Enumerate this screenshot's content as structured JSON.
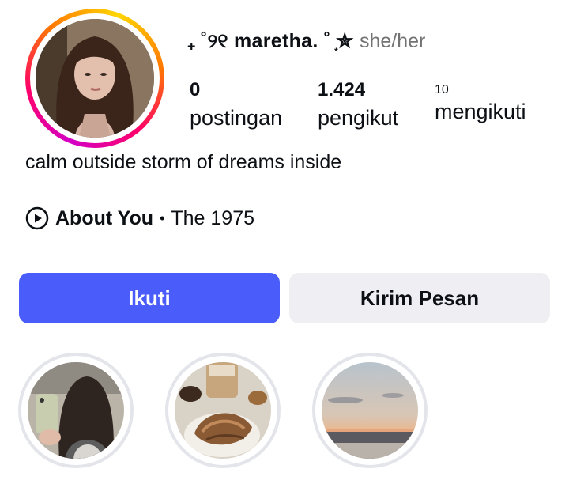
{
  "profile": {
    "username": "₊ ˚୨୧ maretha. ˚ ͙✮",
    "pronouns": "she/her",
    "bio": "calm outside storm of dreams inside"
  },
  "stats": [
    {
      "value": "0",
      "label": "postingan"
    },
    {
      "value": "1.424",
      "label": "pengikut"
    },
    {
      "value": "10",
      "label": "mengikuti"
    }
  ],
  "music": {
    "icon": "play-circle-icon",
    "title": "About You",
    "separator": "•",
    "artist": "The 1975"
  },
  "actions": {
    "follow_label": "Ikuti",
    "message_label": "Kirim Pesan"
  },
  "colors": {
    "follow_button": "#4a5dfb",
    "message_button": "#efeff3",
    "story_ring": [
      "#d300c5",
      "#ff0069",
      "#ff7a00",
      "#ffd600"
    ]
  },
  "highlights": [
    {
      "icon": "mirror-selfie-photo"
    },
    {
      "icon": "coffee-pastry-photo"
    },
    {
      "icon": "sunset-sea-photo"
    }
  ]
}
